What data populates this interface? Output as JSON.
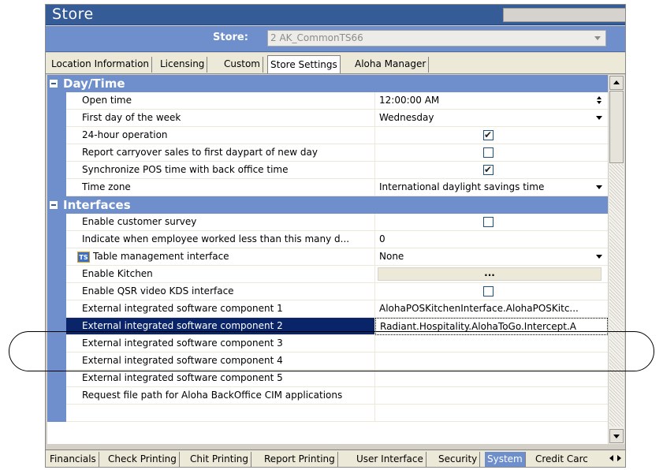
{
  "window": {
    "title": "Store"
  },
  "store_selector": {
    "label": "Store:",
    "value": "2 AK_CommonTS66"
  },
  "top_tabs": [
    {
      "label": "Location Information",
      "active": false
    },
    {
      "label": "Licensing",
      "active": false
    },
    {
      "label": "Custom",
      "active": false
    },
    {
      "label": "Store Settings",
      "active": true
    },
    {
      "label": "Aloha Manager",
      "active": false
    }
  ],
  "grid": {
    "categories": [
      {
        "label": "Day/Time",
        "rows": [
          {
            "name": "Open time",
            "type": "spin",
            "value": "12:00:00 AM"
          },
          {
            "name": "First day of the week",
            "type": "dropdown",
            "value": "Wednesday"
          },
          {
            "name": "24-hour operation",
            "type": "checkbox",
            "checked": true
          },
          {
            "name": "Report carryover sales to first daypart of new day",
            "type": "checkbox",
            "checked": false
          },
          {
            "name": "Synchronize POS time with back office time",
            "type": "checkbox",
            "checked": true
          },
          {
            "name": "Time zone",
            "type": "dropdown",
            "value": "International daylight savings time"
          }
        ]
      },
      {
        "label": "Interfaces",
        "rows": [
          {
            "name": "Enable customer survey",
            "type": "checkbox",
            "checked": false
          },
          {
            "name": "Indicate when employee worked less than this many d...",
            "type": "text",
            "value": "0"
          },
          {
            "name": "Table management interface",
            "type": "dropdown",
            "value": "None",
            "icon": "ts-icon",
            "icon_text": "TS"
          },
          {
            "name": "Enable Kitchen",
            "type": "ellipsis",
            "value": "..."
          },
          {
            "name": "Enable QSR video KDS interface",
            "type": "checkbox",
            "checked": false
          },
          {
            "name": "External integrated software component 1",
            "type": "text",
            "value": "AlohaPOSKitchenInterface.AlohaPOSKitc..."
          },
          {
            "name": "External integrated software component 2",
            "type": "text",
            "value": "Radiant.Hospitality.AlohaToGo.Intercept.A",
            "selected": true
          },
          {
            "name": "External integrated software component 3",
            "type": "text",
            "value": ""
          },
          {
            "name": "External integrated software component 4",
            "type": "text",
            "value": ""
          },
          {
            "name": "External integrated software component 5",
            "type": "text",
            "value": ""
          },
          {
            "name": "Request file path for Aloha BackOffice CIM applications",
            "type": "text",
            "value": ""
          }
        ]
      }
    ]
  },
  "bottom_tabs": [
    {
      "label": "Financials",
      "active": false
    },
    {
      "label": "Check Printing",
      "active": false
    },
    {
      "label": "Chit Printing",
      "active": false
    },
    {
      "label": "Report Printing",
      "active": false
    },
    {
      "label": "User Interface",
      "active": false
    },
    {
      "label": "Security",
      "active": false
    },
    {
      "label": "System",
      "active": true
    },
    {
      "label": "Credit Carc",
      "active": false
    }
  ],
  "colors": {
    "title_bar": "#355c97",
    "category": "#6e8fcb",
    "selection": "#0a246a"
  }
}
